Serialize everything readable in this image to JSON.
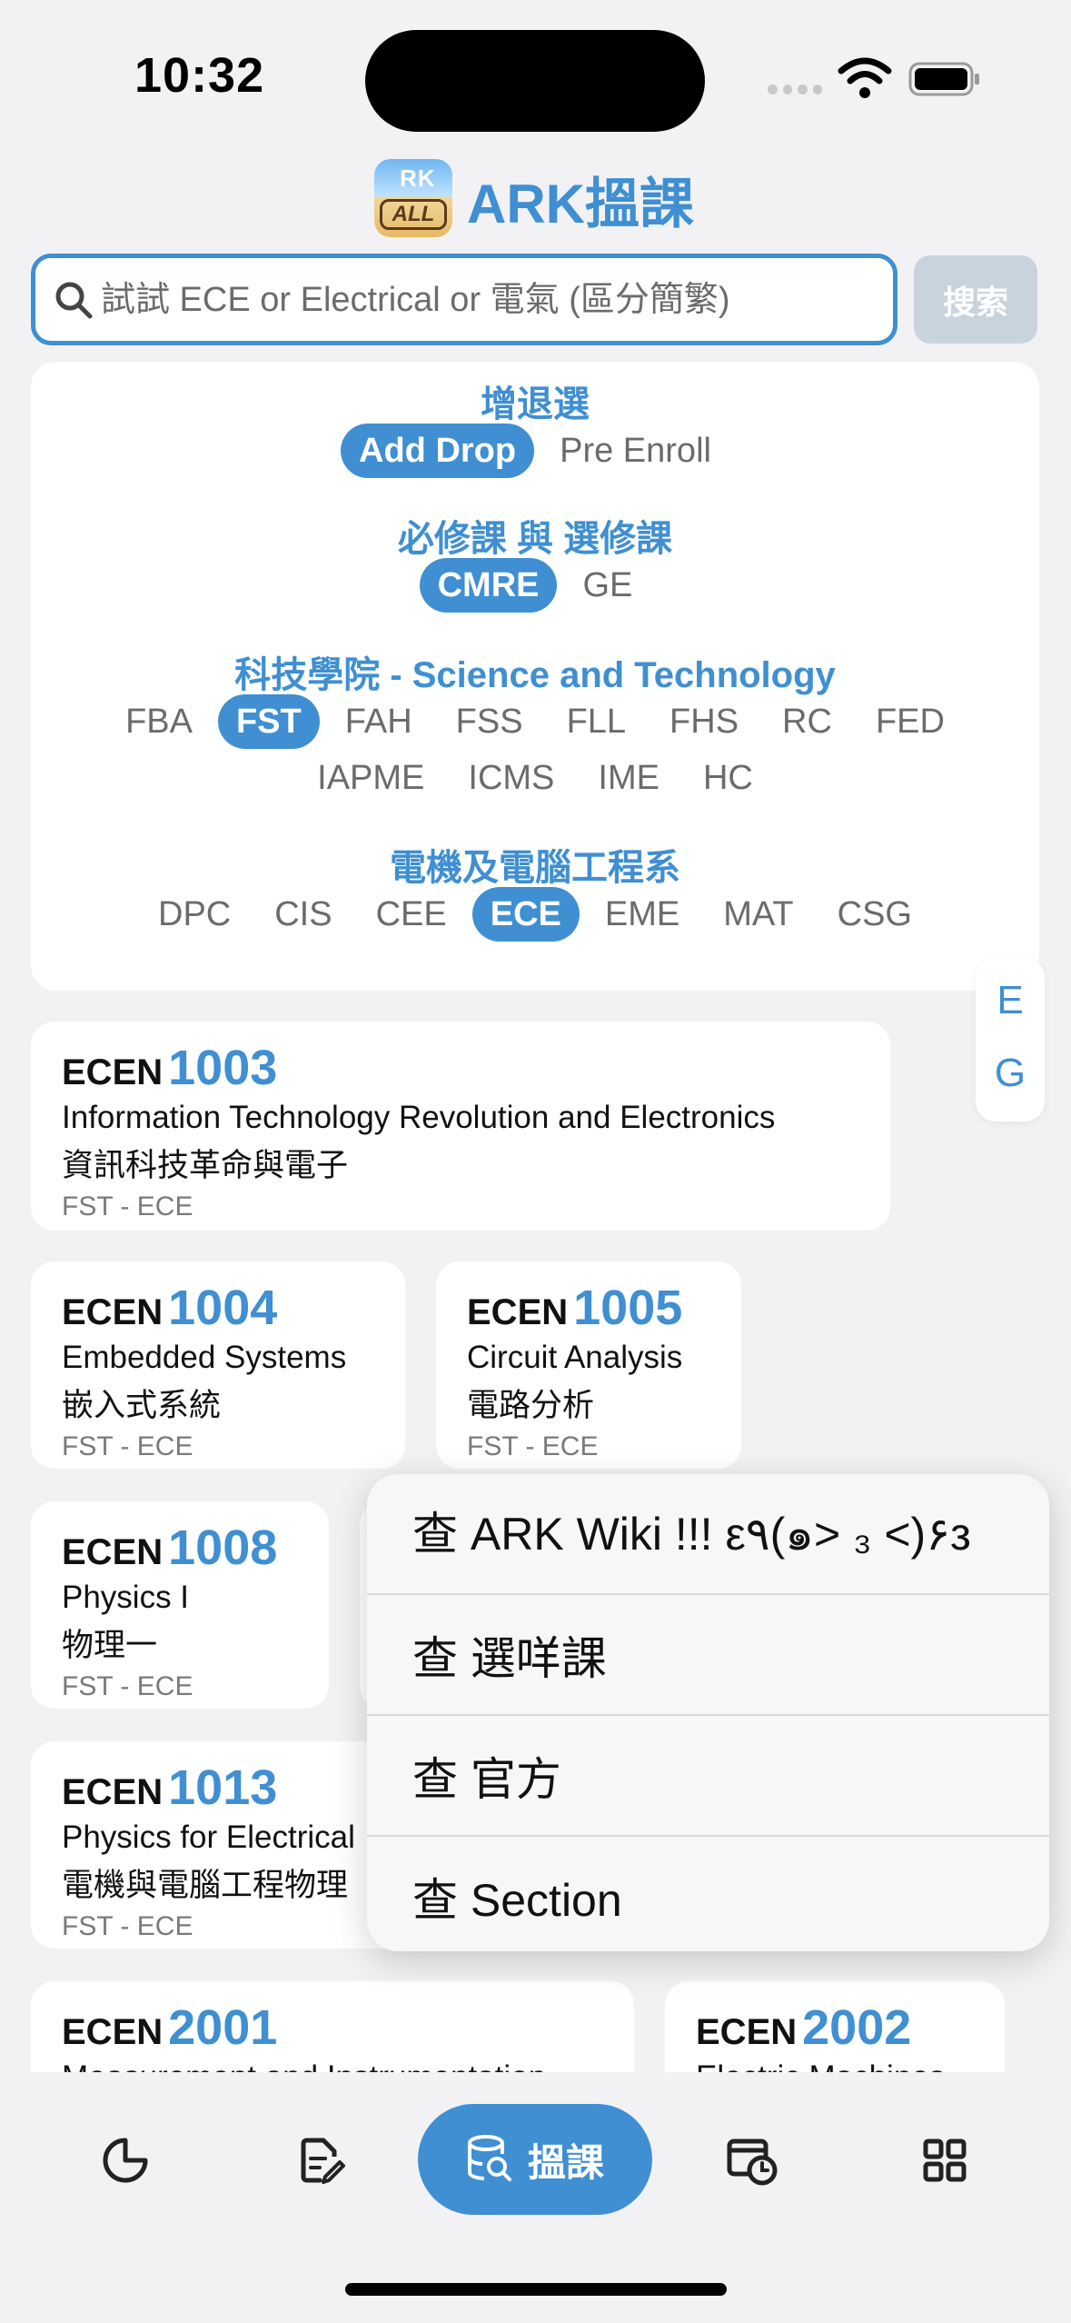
{
  "status": {
    "time": "10:32"
  },
  "header": {
    "logo_top": "RK",
    "logo_bottom": "ALL",
    "title": "ARK搵課"
  },
  "search": {
    "placeholder": "試試 ECE or Electrical or 電氣 (區分簡繁)",
    "button": "搜索"
  },
  "filters": {
    "mode": {
      "title": "增退選",
      "options": [
        "Add Drop",
        "Pre Enroll"
      ],
      "selected": "Add Drop"
    },
    "type": {
      "title": "必修課 與 選修課",
      "options": [
        "CMRE",
        "GE"
      ],
      "selected": "CMRE"
    },
    "faculty": {
      "title": "科技學院 - Science and Technology",
      "options_row1": [
        "FBA",
        "FST",
        "FAH",
        "FSS",
        "FLL",
        "FHS",
        "RC",
        "FED"
      ],
      "options_row2": [
        "IAPME",
        "ICMS",
        "IME",
        "HC"
      ],
      "selected": "FST"
    },
    "department": {
      "title": "電機及電腦工程系",
      "options": [
        "DPC",
        "CIS",
        "CEE",
        "ECE",
        "EME",
        "MAT",
        "CSG"
      ],
      "selected": "ECE"
    }
  },
  "index": [
    "E",
    "G"
  ],
  "courses": [
    {
      "prefix": "ECEN",
      "num": "1003",
      "en": "Information Technology Revolution and Electronics",
      "zh": "資訊科技革命與電子",
      "fac": "FST - ECE"
    },
    {
      "prefix": "ECEN",
      "num": "1004",
      "en": "Embedded Systems",
      "zh": "嵌入式系統",
      "fac": "FST - ECE"
    },
    {
      "prefix": "ECEN",
      "num": "1005",
      "en": "Circuit Analysis",
      "zh": "電路分析",
      "fac": "FST - ECE"
    },
    {
      "prefix": "ECEN",
      "num": "1008",
      "en": "Physics I",
      "zh": "物理一",
      "fac": "FST - ECE"
    },
    {
      "prefix": "ECEN",
      "num": "1013",
      "en": "Physics for Electrical",
      "zh": "電機與電腦工程物理",
      "fac": "FST - ECE"
    },
    {
      "prefix": "ECEN",
      "num": "2001",
      "en": "Measurement and Instrumentation",
      "zh": "",
      "fac": ""
    },
    {
      "prefix": "ECEN",
      "num": "2002",
      "en": "Electric Machines",
      "zh": "",
      "fac": ""
    }
  ],
  "context_menu": [
    "查 ARK Wiki !!!  ε٩(๑> ₃ <)۶з",
    "查 選咩課",
    "查 官方",
    "查 Section"
  ],
  "tabbar": {
    "center_label": "搵課"
  },
  "colors": {
    "accent": "#3f8fd2",
    "background": "#f2f2f4",
    "muted_button": "#c9d3dd"
  },
  "icons": [
    "search-icon",
    "pie-chart-icon",
    "edit-document-icon",
    "database-search-icon",
    "calendar-clock-icon",
    "grid-icon",
    "wifi-icon",
    "battery-icon"
  ]
}
